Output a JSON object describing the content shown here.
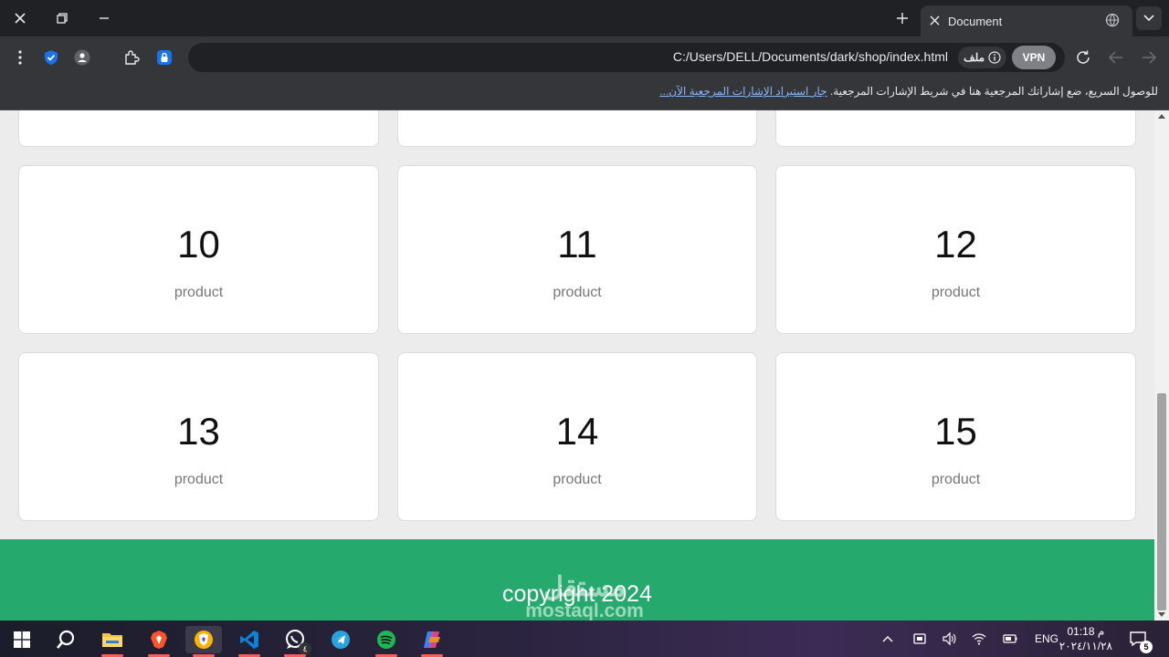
{
  "browser": {
    "tab_title": "Document",
    "url": "C:/Users/DELL/Documents/dark/shop/index.html",
    "file_chip": "ملف",
    "vpn_label": "VPN",
    "bookmark_hint": "للوصول السريع، ضع إشاراتك المرجعية هنا في شريط الإشارات المرجعية.",
    "bookmark_link": "جار استيراد الإشارات المرجعية الآن..."
  },
  "page": {
    "products": [
      {
        "number": "10",
        "label": "product"
      },
      {
        "number": "11",
        "label": "product"
      },
      {
        "number": "12",
        "label": "product"
      },
      {
        "number": "13",
        "label": "product"
      },
      {
        "number": "14",
        "label": "product"
      },
      {
        "number": "15",
        "label": "product"
      }
    ],
    "footer_text": "copyright 2024",
    "footer_color": "#26a96c"
  },
  "watermark": {
    "arabic": "مستقل",
    "latin": "mostaql.com"
  },
  "taskbar": {
    "language": "ENG",
    "time": "01:18 م",
    "date": "٢٠٢٤/١١/٢٨",
    "notification_count": "5",
    "whatsapp_badge": "٤",
    "icons": [
      "start-icon",
      "search-icon",
      "file-explorer-icon",
      "brave-icon",
      "brave-browser-icon",
      "vscode-icon",
      "whatsapp-icon",
      "telegram-icon",
      "spotify-icon",
      "copilot-icon"
    ]
  }
}
